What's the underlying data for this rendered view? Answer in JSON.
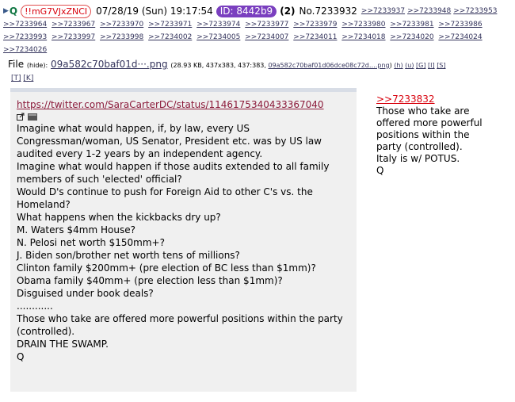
{
  "header": {
    "name": "Q",
    "tripcode": "!!mG7VJxZNCI",
    "datetime": "07/28/19 (Sun) 19:17:54",
    "poster_id": "ID: 8442b9",
    "id_count": "(2)",
    "post_no": "No.7233932",
    "backlinks": [
      ">>7233937",
      ">>7233948",
      ">>7233953",
      ">>7233964",
      ">>7233967",
      ">>7233970",
      ">>7233971",
      ">>7233974",
      ">>7233977",
      ">>7233979",
      ">>7233980",
      ">>7233981",
      ">>7233986",
      ">>7233993",
      ">>7233997",
      ">>7233998",
      ">>7234002",
      ">>7234005",
      ">>7234007",
      ">>7234011",
      ">>7234018",
      ">>7234020",
      ">>7234024",
      ">>7234026"
    ]
  },
  "file": {
    "label": "File",
    "hide": "(hide):",
    "filename": "09a582c70baf01d···.png",
    "info": "(28.93 KB, 437x383, 437:383, ",
    "fullname": "09a582c70baf01d06dce08c72d….png",
    "info_end": ")",
    "links": [
      "(h)",
      "(u)",
      "[G]",
      "[I]",
      "[S]"
    ],
    "links2": [
      "[T]",
      "[K]"
    ]
  },
  "image_text": {
    "url": "https://twitter.com/SaraCarterDC/status/1146175340433367040",
    "lines": [
      "Imagine what would happen, if, by law, every US",
      "Congressman/woman, US Senator, President etc. was by US law",
      "audited every 1-2 years by an independent agency.",
      "Imagine what would happen if those audits extended to all family",
      "members of such 'elected' official?",
      "Would D's continue to push for Foreign Aid to other C's vs. the",
      "Homeland?",
      "What happens when the kickbacks dry up?",
      "M. Waters $4mm House?",
      "N. Pelosi net worth $150mm+?",
      "J. Biden son/brother net worth tens of millions?",
      "Clinton family $200mm+ (pre election of BC less than $1mm)?",
      "Obama family $40mm+ (pre election less than $1mm)?",
      "Disguised under book deals?",
      "............",
      "Those who take are offered more powerful positions within the party",
      "(controlled).",
      "DRAIN THE SWAMP.",
      "Q"
    ]
  },
  "comment": {
    "ref": ">>7233832",
    "lines": [
      "Those who take are",
      "offered more powerful",
      "positions within the",
      "party (controlled).",
      "Italy is w/ POTUS.",
      "Q"
    ]
  }
}
